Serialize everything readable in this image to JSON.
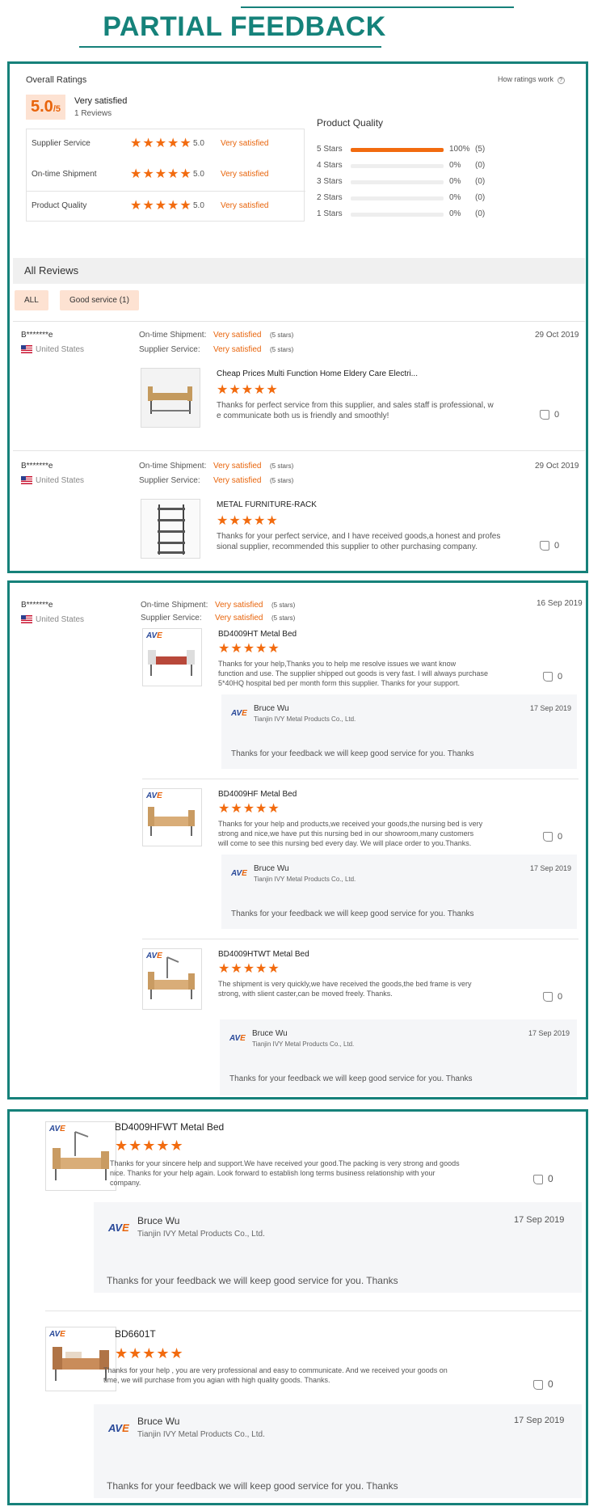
{
  "header": {
    "title": "PARTIAL FEEDBACK"
  },
  "overall": {
    "label": "Overall Ratings",
    "how_link": "How ratings work",
    "score": "5.0",
    "score_suffix": "/5",
    "summary": "Very satisfied",
    "reviews_count": "1 Reviews",
    "rows": [
      {
        "label": "Supplier Service",
        "score": "5.0",
        "text": "Very satisfied",
        "stars": 5
      },
      {
        "label": "On-time Shipment",
        "score": "5.0",
        "text": "Very satisfied",
        "stars": 5
      },
      {
        "label": "Product Quality",
        "score": "5.0",
        "text": "Very satisfied",
        "stars": 5
      }
    ],
    "distribution_title": "Product Quality",
    "distribution": [
      {
        "label": "5 Stars",
        "pct": "100%",
        "count": "(5)",
        "fraction": 1.0
      },
      {
        "label": "4 Stars",
        "pct": "0%",
        "count": "(0)",
        "fraction": 0
      },
      {
        "label": "3 Stars",
        "pct": "0%",
        "count": "(0)",
        "fraction": 0
      },
      {
        "label": "2 Stars",
        "pct": "0%",
        "count": "(0)",
        "fraction": 0
      },
      {
        "label": "1 Stars",
        "pct": "0%",
        "count": "(0)",
        "fraction": 0
      }
    ]
  },
  "all_reviews": {
    "title": "All Reviews",
    "filters": [
      "ALL",
      "Good service (1)"
    ]
  },
  "labels": {
    "ontime": "On-time Shipment:",
    "supplier": "Supplier Service:",
    "very_satisfied": "Very satisfied",
    "five_stars": "(5 stars)",
    "country": "United States"
  },
  "panel1_reviews": [
    {
      "user": "B*******e",
      "date": "29 Oct 2019",
      "product": "Cheap Prices Multi Function Home Eldery Care Electri...",
      "text_lines": [
        "Thanks for perfect service from this supplier, and sales staff is professional, w",
        "e communicate both us is friendly and smoothly!"
      ],
      "likes": "0"
    },
    {
      "user": "B*******e",
      "date": "29 Oct 2019",
      "product": "METAL FURNITURE-RACK",
      "text_lines": [
        "Thanks for your perfect service, and I have received goods,a honest and profes",
        "sional supplier, recommended this supplier to other purchasing company."
      ],
      "likes": "0"
    }
  ],
  "panel2": {
    "user": "B*******e",
    "date": "16 Sep 2019",
    "items": [
      {
        "product": "BD4009HT Metal Bed",
        "text_lines": [
          "Thanks for your help,Thanks you to help me resolve issues we want know",
          "function and use. The supplier shipped out goods is very fast. I will always purchase",
          "5*40HQ hospital bed per month form this supplier. Thanks for your support."
        ],
        "likes": "0",
        "reply": {
          "name": "Bruce Wu",
          "company": "Tianjin IVY Metal Products Co., Ltd.",
          "date": "17 Sep 2019",
          "text": "Thanks for your feedback we will keep good service for you. Thanks"
        }
      },
      {
        "product": "BD4009HF Metal Bed",
        "text_lines": [
          "Thanks for your help and products,we received your goods,the nursing bed is very",
          "strong and nice,we have put this nursing bed in our showroom,many customers",
          "will come to see this nursing bed every day. We will place order to you.Thanks."
        ],
        "likes": "0",
        "reply": {
          "name": "Bruce Wu",
          "company": "Tianjin IVY Metal Products Co., Ltd.",
          "date": "17 Sep 2019",
          "text": "Thanks for your feedback we will keep good service for you. Thanks"
        }
      },
      {
        "product": "BD4009HTWT Metal Bed",
        "text_lines": [
          "The shipment is very quickly,we have received the goods,the bed frame is very",
          "strong, with slient caster,can be moved freely. Thanks."
        ],
        "likes": "0",
        "reply": {
          "name": "Bruce Wu",
          "company": "Tianjin IVY Metal Products Co., Ltd.",
          "date": "17 Sep 2019",
          "text": "Thanks for your feedback we will keep good service for you. Thanks"
        }
      }
    ]
  },
  "panel3": {
    "items": [
      {
        "product": "BD4009HFWT Metal Bed",
        "text_lines": [
          "Thanks for your sincere help and support.We have received your good.The packing is very strong and goods",
          "nice. Thanks for your help again. Look forward to establish long terms business relationship with your",
          "company."
        ],
        "likes": "0",
        "reply": {
          "name": "Bruce Wu",
          "company": "Tianjin IVY Metal Products Co., Ltd.",
          "date": "17 Sep 2019",
          "text": "Thanks for your feedback we will keep good service for you. Thanks"
        }
      },
      {
        "product": "BD6601T",
        "text_lines": [
          "Thanks for your help , you are very professional and easy to communicate. And we received your goods on",
          "time, we will purchase from you agian with high quality goods. Thanks."
        ],
        "likes": "0",
        "reply": {
          "name": "Bruce Wu",
          "company": "Tianjin IVY Metal Products Co., Ltd.",
          "date": "17 Sep 2019",
          "text": "Thanks for your feedback we will keep good service for you. Thanks"
        }
      }
    ]
  },
  "colors": {
    "frame": "#16817a",
    "accent": "#f26b0f",
    "chip": "#fde2d2"
  },
  "icons": {
    "star": "star-icon",
    "like": "thumbs-up-icon",
    "flag": "us-flag-icon",
    "logo": "ave-logo"
  }
}
